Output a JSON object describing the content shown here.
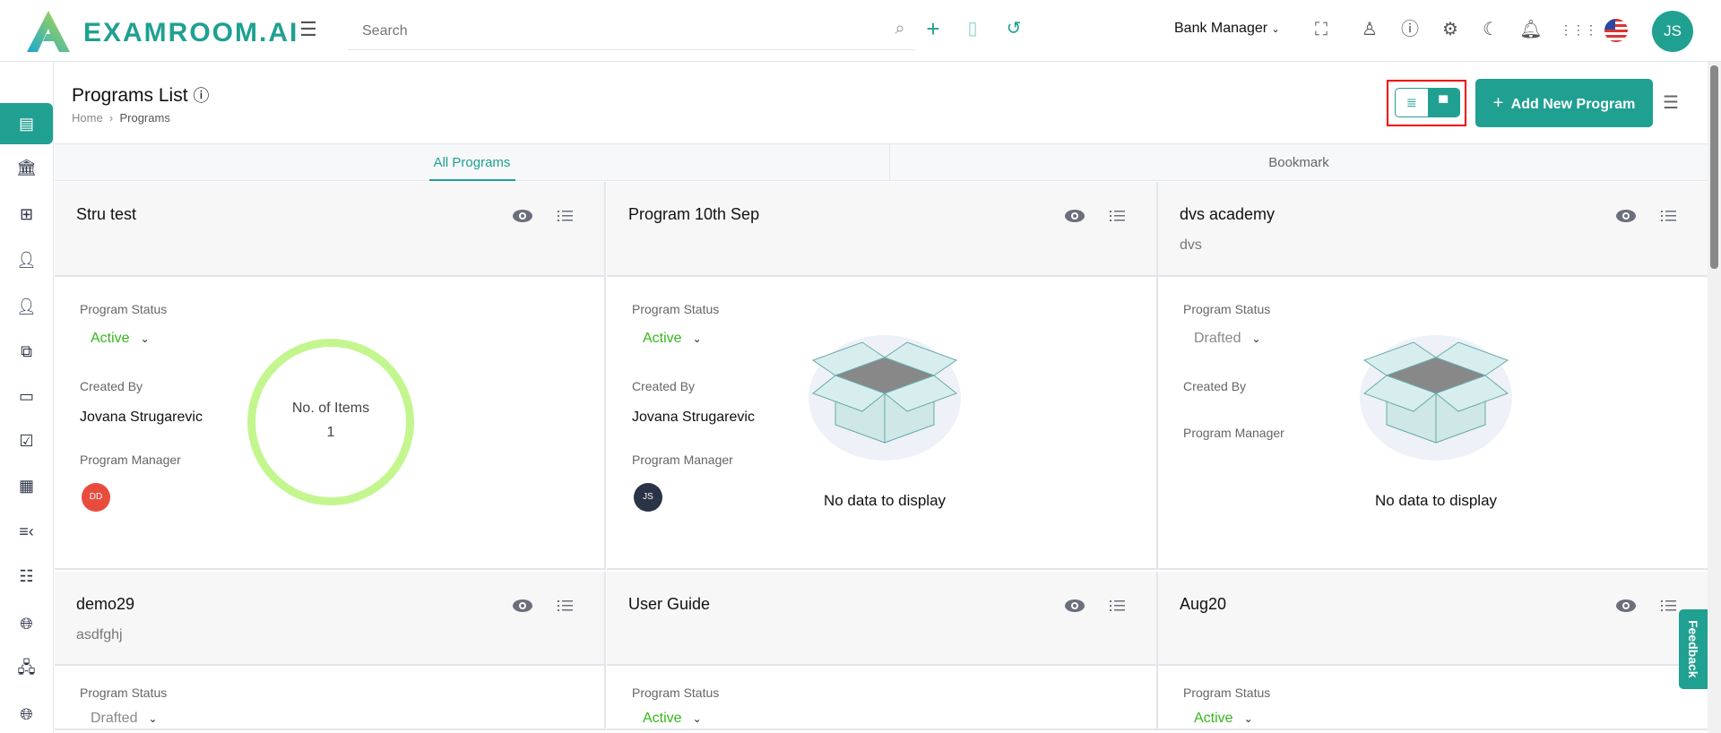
{
  "header": {
    "logo": "EXAMROOM.AI",
    "search_placeholder": "Search",
    "role": "Bank Manager",
    "avatar": "JS"
  },
  "page": {
    "title": "Programs List",
    "breadcrumb": [
      "Home",
      "Programs"
    ],
    "add_button": "Add New Program"
  },
  "tabs": [
    "All Programs",
    "Bookmark"
  ],
  "labels": {
    "status": "Program Status",
    "created_by": "Created By",
    "manager": "Program Manager",
    "items": "No. of Items",
    "no_data": "No data to display"
  },
  "feedback": "Feedback",
  "colors": {
    "accent": "#20a091",
    "active": "#35b61a",
    "drafted": "#888888"
  },
  "cards": [
    {
      "title": "Stru test",
      "subtitle": "",
      "status": "Active",
      "created_by": "Jovana Strugarevic",
      "manager": "DD",
      "manager_color": "#e84c3d",
      "items": "1"
    },
    {
      "title": "Program 10th Sep",
      "subtitle": "",
      "status": "Active",
      "created_by": "Jovana Strugarevic",
      "manager": "JS",
      "manager_color": "#2b3346",
      "items": null
    },
    {
      "title": "dvs academy",
      "subtitle": "dvs",
      "status": "Drafted",
      "created_by": "",
      "manager": "",
      "manager_color": "",
      "items": null
    },
    {
      "title": "demo29",
      "subtitle": "asdfghj",
      "status": "Drafted",
      "created_by": "",
      "manager": "",
      "manager_color": "",
      "items": null
    },
    {
      "title": "User Guide",
      "subtitle": "",
      "status": "Active",
      "created_by": "",
      "manager": "",
      "manager_color": "",
      "items": null
    },
    {
      "title": "Aug20",
      "subtitle": "",
      "status": "Active",
      "created_by": "",
      "manager": "",
      "manager_color": "",
      "items": null
    }
  ]
}
